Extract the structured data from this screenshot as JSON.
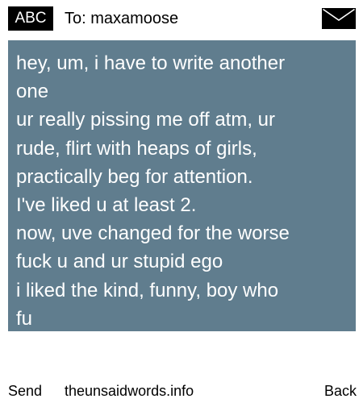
{
  "header": {
    "mode": "ABC",
    "recipient": "To: maxamoose",
    "icon": "envelope-icon"
  },
  "message": {
    "lines": [
      "hey, um, i have to write another",
      "one",
      "ur really pissing me off atm, ur",
      "rude, flirt with heaps of girls,",
      "practically beg for attention.",
      "I've liked u at least 2.",
      "now, uve changed for the worse",
      "fuck u and ur stupid ego",
      "i liked the kind, funny, boy who",
      "fu"
    ],
    "background_color": "#607d8e",
    "text_color": "#ffffff"
  },
  "footer": {
    "send_label": "Send",
    "site": "theunsaidwords.info",
    "back_label": "Back"
  }
}
